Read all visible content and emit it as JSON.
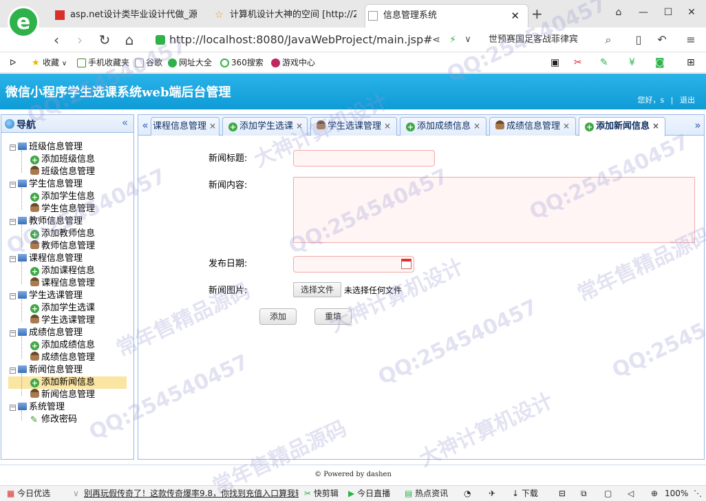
{
  "browser": {
    "tabs": [
      {
        "label": "asp.net设计类毕业设计代做_源...",
        "active": false
      },
      {
        "label": "计算机设计大神的空间 [http://2...",
        "active": false
      },
      {
        "label": "信息管理系统",
        "active": true
      }
    ],
    "new_tab": "+",
    "url": "http://localhost:8080/JavaWebProject/main.jsp#",
    "search_text": "世预赛国足客战菲律宾",
    "favorites": [
      "收藏",
      "手机收藏夹",
      "谷歌",
      "网址大全",
      "360搜索",
      "游戏中心"
    ]
  },
  "app": {
    "title": "微信小程序学生选课系统web端后台管理",
    "user_greeting": "您好，s",
    "logout": "退出",
    "separator": "|"
  },
  "nav": {
    "title": "导航",
    "collapse_icon": "«",
    "groups": [
      {
        "label": "班级信息管理",
        "items": [
          "添加班级信息",
          "班级信息管理"
        ]
      },
      {
        "label": "学生信息管理",
        "items": [
          "添加学生信息",
          "学生信息管理"
        ]
      },
      {
        "label": "教师信息管理",
        "items": [
          "添加教师信息",
          "教师信息管理"
        ]
      },
      {
        "label": "课程信息管理",
        "items": [
          "添加课程信息",
          "课程信息管理"
        ]
      },
      {
        "label": "学生选课管理",
        "items": [
          "添加学生选课",
          "学生选课管理"
        ]
      },
      {
        "label": "成绩信息管理",
        "items": [
          "添加成绩信息",
          "成绩信息管理"
        ]
      },
      {
        "label": "新闻信息管理",
        "items": [
          "添加新闻信息",
          "新闻信息管理"
        ]
      },
      {
        "label": "系统管理",
        "items": [
          "修改密码"
        ]
      }
    ],
    "selected": "添加新闻信息"
  },
  "content_tabs": [
    {
      "label": "课程信息管理",
      "icon": "none"
    },
    {
      "label": "添加学生选课",
      "icon": "add"
    },
    {
      "label": "学生选课管理",
      "icon": "user"
    },
    {
      "label": "添加成绩信息",
      "icon": "add"
    },
    {
      "label": "成绩信息管理",
      "icon": "user"
    },
    {
      "label": "添加新闻信息",
      "icon": "add",
      "active": true
    }
  ],
  "form": {
    "title_label": "新闻标题:",
    "content_label": "新闻内容:",
    "date_label": "发布日期:",
    "image_label": "新闻图片:",
    "file_button": "选择文件",
    "file_status": "未选择任何文件",
    "submit": "添加",
    "reset": "重填"
  },
  "footer": "© Powered by dashen",
  "statusbar": {
    "left": "今日优选",
    "news": "别再玩假传奇了！这款传奇爆率9.8，你找到充值入口算我输",
    "items": [
      "快剪辑",
      "今日直播",
      "热点资讯",
      "下载"
    ],
    "zoom": "100%"
  },
  "watermarks": [
    "大神计算机设计",
    "QQ:254540457",
    "常年售精品源码"
  ]
}
